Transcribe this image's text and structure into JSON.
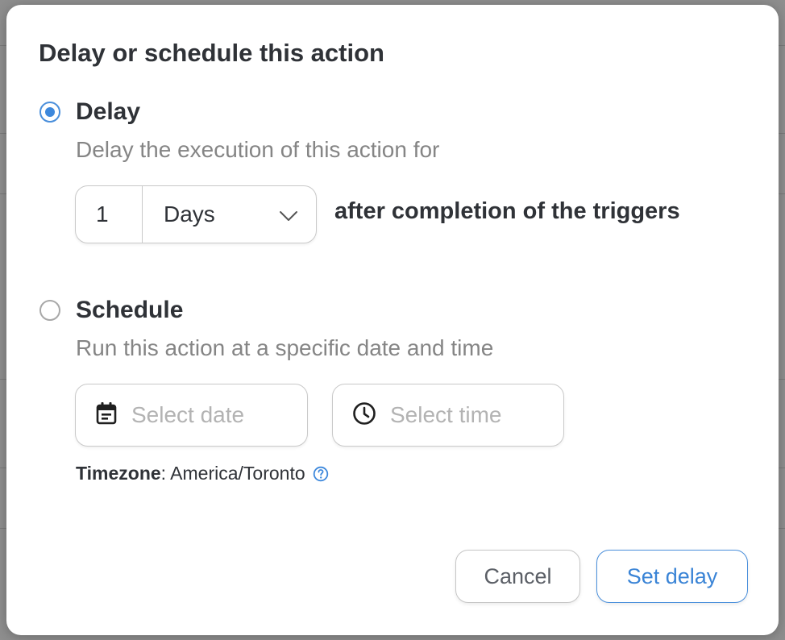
{
  "dialog": {
    "title": "Delay or schedule this action"
  },
  "delay_option": {
    "selected": true,
    "label": "Delay",
    "description": "Delay the execution of this action for",
    "amount": "1",
    "unit": "Days",
    "suffix": "after completion of the triggers"
  },
  "schedule_option": {
    "selected": false,
    "label": "Schedule",
    "description": "Run this action at a specific date and time",
    "date_placeholder": "Select date",
    "time_placeholder": "Select time"
  },
  "timezone": {
    "label": "Timezone",
    "value": ": America/Toronto"
  },
  "buttons": {
    "cancel": "Cancel",
    "submit": "Set delay"
  },
  "colors": {
    "accent": "#3d88dc",
    "text": "#2f3237",
    "muted": "#858585"
  },
  "icons": {
    "unit_dropdown": "chevron-down-icon",
    "date": "calendar-icon",
    "time": "clock-icon",
    "help": "help-circle-icon"
  }
}
